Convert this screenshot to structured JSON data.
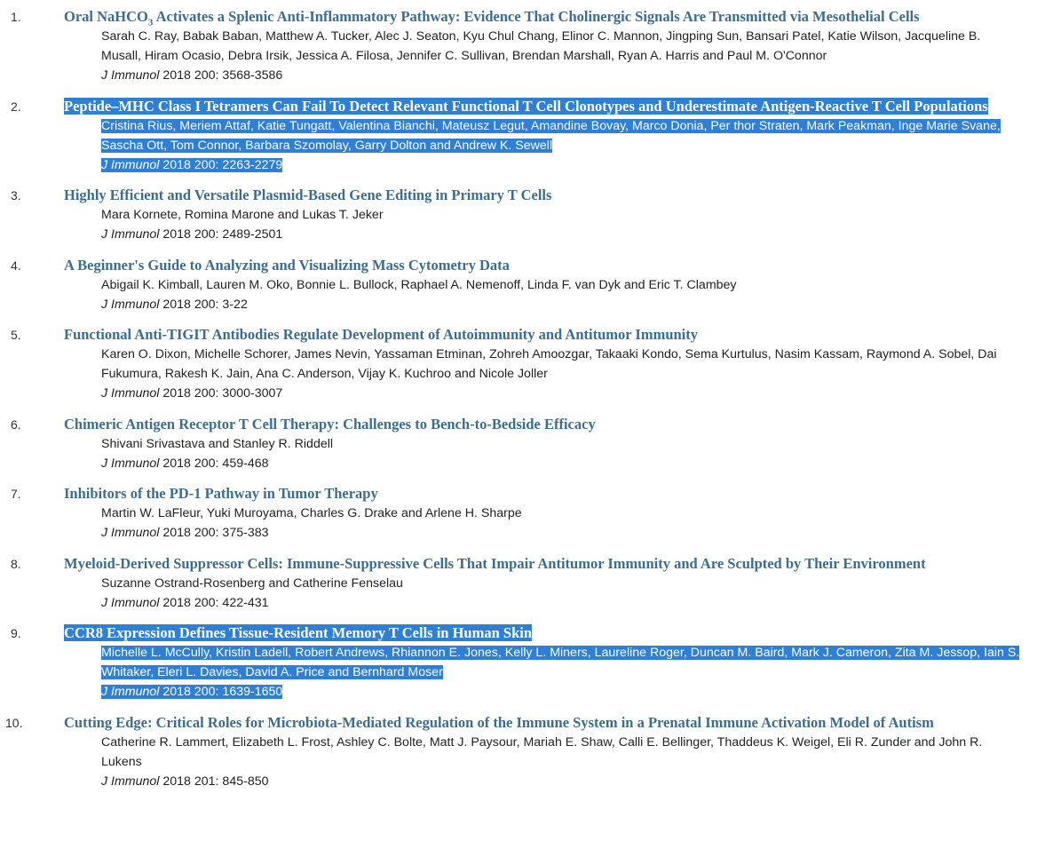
{
  "articles": [
    {
      "number": "1.",
      "title_pre": "Oral NaHCO",
      "title_sub": "3",
      "title_post": " Activates a Splenic Anti-Inflammatory Pathway: Evidence That Cholinergic Signals Are Transmitted via Mesothelial Cells",
      "authors": "Sarah C. Ray, Babak Baban, Matthew A. Tucker, Alec J. Seaton, Kyu Chul Chang, Elinor C. Mannon, Jingping Sun, Bansari Patel, Katie Wilson, Jacqueline B. Musall, Hiram Ocasio, Debra Irsik, Jessica A. Filosa, Jennifer C. Sullivan, Brendan Marshall, Ryan A. Harris and Paul M. O'Connor",
      "journal": "J Immunol",
      "cite": " 2018 200: 3568-3586",
      "selected": false
    },
    {
      "number": "2.",
      "title": "Peptide–MHC Class I Tetramers Can Fail To Detect Relevant Functional T Cell Clonotypes and Underestimate Antigen-Reactive T Cell Populations",
      "authors": "Cristina Rius, Meriem Attaf, Katie Tungatt, Valentina Bianchi, Mateusz Legut, Amandine Bovay, Marco Donia, Per thor Straten, Mark Peakman, Inge Marie Svane, Sascha Ott, Tom Connor, Barbara Szomolay, Garry Dolton and Andrew K. Sewell",
      "journal": "J Immunol",
      "cite": " 2018 200: 2263-2279",
      "selected": true
    },
    {
      "number": "3.",
      "title": "Highly Efficient and Versatile Plasmid-Based Gene Editing in Primary T Cells",
      "authors": "Mara Kornete, Romina Marone and Lukas T. Jeker",
      "journal": "J Immunol",
      "cite": " 2018 200: 2489-2501",
      "selected": false
    },
    {
      "number": "4.",
      "title": "A Beginner's Guide to Analyzing and Visualizing Mass Cytometry Data",
      "authors": "Abigail K. Kimball, Lauren M. Oko, Bonnie L. Bullock, Raphael A. Nemenoff, Linda F. van Dyk and Eric T. Clambey",
      "journal": "J Immunol",
      "cite": " 2018 200: 3-22",
      "selected": false
    },
    {
      "number": "5.",
      "title": "Functional Anti-TIGIT Antibodies Regulate Development of Autoimmunity and Antitumor Immunity",
      "authors": "Karen O. Dixon, Michelle Schorer, James Nevin, Yassaman Etminan, Zohreh Amoozgar, Takaaki Kondo, Sema Kurtulus, Nasim Kassam, Raymond A. Sobel, Dai Fukumura, Rakesh K. Jain, Ana C. Anderson, Vijay K. Kuchroo and Nicole Joller",
      "journal": "J Immunol",
      "cite": " 2018 200: 3000-3007",
      "selected": false
    },
    {
      "number": "6.",
      "title": "Chimeric Antigen Receptor T Cell Therapy: Challenges to Bench-to-Bedside Efficacy",
      "authors": "Shivani Srivastava and Stanley R. Riddell",
      "journal": "J Immunol",
      "cite": " 2018 200: 459-468",
      "selected": false
    },
    {
      "number": "7.",
      "title": "Inhibitors of the PD-1 Pathway in Tumor Therapy",
      "authors": "Martin W. LaFleur, Yuki Muroyama, Charles G. Drake and Arlene H. Sharpe",
      "journal": "J Immunol",
      "cite": " 2018 200: 375-383",
      "selected": false
    },
    {
      "number": "8.",
      "title": "Myeloid-Derived Suppressor Cells: Immune-Suppressive Cells That Impair Antitumor Immunity and Are Sculpted by Their Environment",
      "authors": "Suzanne Ostrand-Rosenberg and Catherine Fenselau",
      "journal": "J Immunol",
      "cite": " 2018 200: 422-431",
      "selected": false
    },
    {
      "number": "9.",
      "title": "CCR8 Expression Defines Tissue-Resident Memory T Cells in Human Skin",
      "authors": "Michelle L. McCully, Kristin Ladell, Robert Andrews, Rhiannon E. Jones, Kelly L. Miners, Laureline Roger, Duncan M. Baird, Mark J. Cameron, Zita M. Jessop, Iain S. Whitaker, Eleri L. Davies, David A. Price and Bernhard Moser",
      "journal": "J Immunol",
      "cite": " 2018 200: 1639-1650",
      "selected": true
    },
    {
      "number": "10.",
      "title": "Cutting Edge: Critical Roles for Microbiota-Mediated Regulation of the Immune System in a Prenatal Immune Activation Model of Autism",
      "authors": "Catherine R. Lammert, Elizabeth L. Frost, Ashley C. Bolte, Matt J. Paysour, Mariah E. Shaw, Calli E. Bellinger, Thaddeus K. Weigel, Eli R. Zunder and John R. Lukens",
      "journal": "J Immunol",
      "cite": " 2018 201: 845-850",
      "selected": false
    }
  ]
}
